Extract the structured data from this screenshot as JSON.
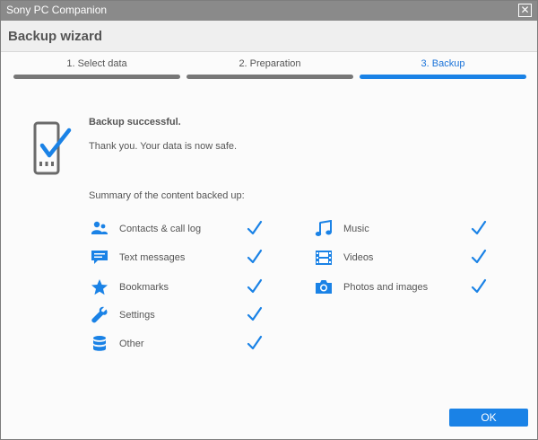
{
  "window": {
    "title": "Sony PC Companion",
    "close_glyph": "✕"
  },
  "header": {
    "title": "Backup wizard"
  },
  "steps": [
    {
      "label": "1. Select data",
      "state": "done"
    },
    {
      "label": "2. Preparation",
      "state": "done"
    },
    {
      "label": "3. Backup",
      "state": "active"
    }
  ],
  "result": {
    "title": "Backup successful.",
    "text": "Thank you. Your data is now safe.",
    "icon": "phone-check-icon"
  },
  "summary": {
    "title": "Summary of the content backed up:",
    "items": [
      {
        "label": "Contacts & call log",
        "icon": "contacts-icon",
        "checked": true
      },
      {
        "label": "Text messages",
        "icon": "message-icon",
        "checked": true
      },
      {
        "label": "Bookmarks",
        "icon": "star-icon",
        "checked": true
      },
      {
        "label": "Settings",
        "icon": "wrench-icon",
        "checked": true
      },
      {
        "label": "Other",
        "icon": "database-icon",
        "checked": true
      },
      {
        "label": "Music",
        "icon": "music-icon",
        "checked": true
      },
      {
        "label": "Videos",
        "icon": "film-icon",
        "checked": true
      },
      {
        "label": "Photos and images",
        "icon": "camera-icon",
        "checked": true
      }
    ]
  },
  "footer": {
    "ok_label": "OK"
  },
  "colors": {
    "accent": "#1a82e6",
    "titlebar": "#8a8a8a",
    "done_bar": "#777777"
  }
}
